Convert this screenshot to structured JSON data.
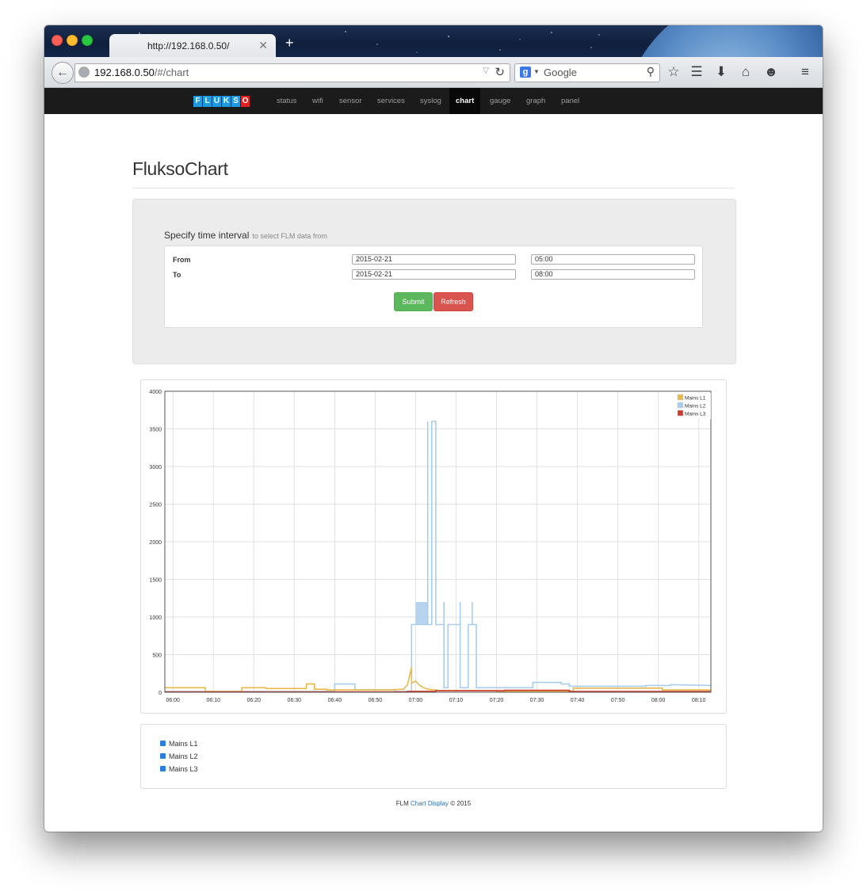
{
  "browser": {
    "tab_title": "http://192.168.0.50/",
    "url_host": "192.168.0.50",
    "url_path": "/#/chart",
    "search_placeholder": "Google"
  },
  "nav": {
    "logo": "FLUKSO",
    "items": [
      {
        "label": "status"
      },
      {
        "label": "wifi"
      },
      {
        "label": "sensor"
      },
      {
        "label": "services"
      },
      {
        "label": "syslog"
      },
      {
        "label": "chart",
        "active": true
      },
      {
        "label": "gauge"
      },
      {
        "label": "graph"
      },
      {
        "label": "panel"
      }
    ]
  },
  "page": {
    "title": "FluksoChart",
    "interval_title": "Specify time interval",
    "interval_subtitle": "to select FLM data from",
    "from_label": "From",
    "to_label": "To",
    "from_date": "2015-02-21",
    "from_time": "05:00",
    "to_date": "2015-02-21",
    "to_time": "08:00",
    "submit_label": "Submit",
    "refresh_label": "Refresh"
  },
  "series_toggles": [
    {
      "label": "Mains L1",
      "checked": true
    },
    {
      "label": "Mains L2",
      "checked": true
    },
    {
      "label": "Mains L3",
      "checked": true
    }
  ],
  "footer": {
    "prefix": "FLM",
    "link": "Chart Display",
    "suffix": "© 2015"
  },
  "chart_data": {
    "type": "line",
    "title": "",
    "xlabel": "",
    "ylabel": "",
    "ylim": [
      0,
      4000
    ],
    "xlim": [
      "05:58",
      "08:13"
    ],
    "y_ticks": [
      0,
      500,
      1000,
      1500,
      2000,
      2500,
      3000,
      3500,
      4000
    ],
    "x_ticks": [
      "06:00",
      "06:10",
      "06:20",
      "06:30",
      "06:40",
      "06:50",
      "07:00",
      "07:10",
      "07:20",
      "07:30",
      "07:40",
      "07:50",
      "08:00",
      "08:10"
    ],
    "grid": true,
    "legend": "top-right",
    "colors": {
      "Mains L1": "#e8b84a",
      "Mains L2": "#a9cdec",
      "Mains L3": "#cc3a2b"
    },
    "series": [
      {
        "name": "Mains L1",
        "x": [
          "05:58",
          "06:08",
          "06:08",
          "06:17",
          "06:17",
          "06:23",
          "06:23",
          "06:33",
          "06:33",
          "06:35",
          "06:35",
          "06:38",
          "06:38",
          "06:53",
          "06:57",
          "06:58",
          "06:59",
          "06:59",
          "07:00",
          "07:01",
          "07:02",
          "07:03",
          "07:05",
          "07:05",
          "07:20",
          "07:20",
          "07:39",
          "07:39",
          "08:01",
          "08:01",
          "08:13"
        ],
        "values": [
          60,
          60,
          10,
          10,
          60,
          60,
          50,
          50,
          110,
          110,
          40,
          40,
          30,
          30,
          40,
          100,
          330,
          120,
          150,
          90,
          60,
          40,
          30,
          20,
          20,
          15,
          15,
          55,
          55,
          30,
          30
        ]
      },
      {
        "name": "Mains L2",
        "x": [
          "05:58",
          "06:40",
          "06:40",
          "06:45",
          "06:45",
          "06:55",
          "06:55",
          "06:59",
          "06:59",
          "07:03",
          "07:03",
          "07:03",
          "07:04",
          "07:04",
          "07:04",
          "07:05",
          "07:05",
          "07:05",
          "07:07",
          "07:07",
          "07:07",
          "07:08",
          "07:08",
          "07:08",
          "07:11",
          "07:11",
          "07:11",
          "07:13",
          "07:13",
          "07:13",
          "07:14",
          "07:14",
          "07:14",
          "07:15",
          "07:15",
          "07:20",
          "07:29",
          "07:29",
          "07:36",
          "07:36",
          "07:38",
          "07:38",
          "07:57",
          "07:57",
          "08:03",
          "08:03",
          "08:13"
        ],
        "values": [
          10,
          10,
          110,
          110,
          30,
          30,
          10,
          10,
          900,
          900,
          3600,
          900,
          900,
          1750,
          3600,
          3600,
          900,
          900,
          900,
          1200,
          60,
          60,
          900,
          900,
          900,
          1200,
          60,
          60,
          900,
          900,
          900,
          1200,
          900,
          900,
          60,
          60,
          60,
          130,
          130,
          110,
          110,
          80,
          80,
          90,
          90,
          100,
          90
        ]
      },
      {
        "name": "Mains L3",
        "x": [
          "05:58",
          "06:58",
          "06:58",
          "07:05",
          "07:05",
          "07:22",
          "07:22",
          "07:38",
          "07:38",
          "08:13"
        ],
        "values": [
          5,
          5,
          12,
          12,
          20,
          20,
          25,
          25,
          10,
          10
        ]
      }
    ]
  }
}
